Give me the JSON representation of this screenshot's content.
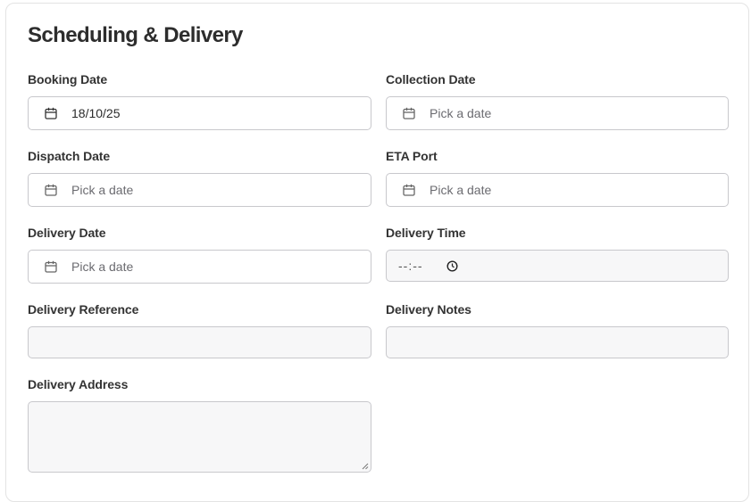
{
  "section": {
    "title": "Scheduling & Delivery"
  },
  "fields": {
    "booking_date": {
      "label": "Booking Date",
      "value": "18/10/25"
    },
    "collection_date": {
      "label": "Collection Date",
      "placeholder": "Pick a date"
    },
    "dispatch_date": {
      "label": "Dispatch Date",
      "placeholder": "Pick a date"
    },
    "eta_port": {
      "label": "ETA Port",
      "placeholder": "Pick a date"
    },
    "delivery_date": {
      "label": "Delivery Date",
      "placeholder": "Pick a date"
    },
    "delivery_time": {
      "label": "Delivery Time",
      "value": "--:--"
    },
    "delivery_reference": {
      "label": "Delivery Reference",
      "value": ""
    },
    "delivery_notes": {
      "label": "Delivery Notes",
      "value": ""
    },
    "delivery_address": {
      "label": "Delivery Address",
      "value": ""
    }
  },
  "icons": {
    "date": "calendar-icon",
    "time": "clock-icon",
    "resize": "resize-grip-icon"
  }
}
